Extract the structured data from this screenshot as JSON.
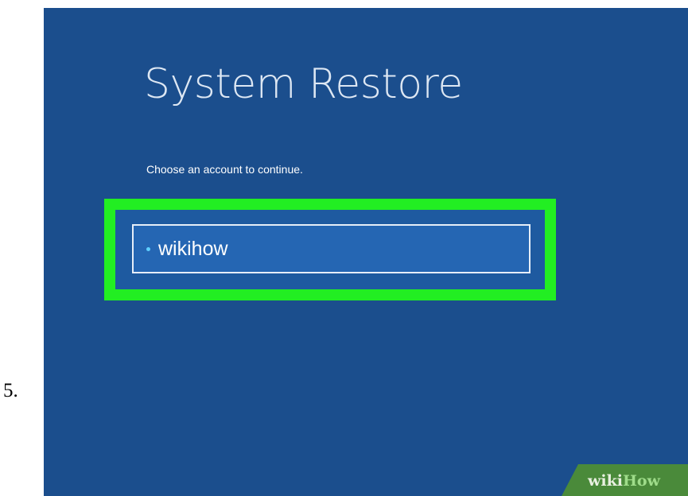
{
  "step": {
    "number": "5."
  },
  "screen": {
    "title": "System Restore",
    "subtitle": "Choose an account to continue.",
    "accounts": [
      {
        "label": "wikihow"
      }
    ],
    "highlight_color": "#22ee22",
    "background_color": "#1b4e8d"
  },
  "watermark": {
    "wiki": "wiki",
    "how": "How"
  }
}
